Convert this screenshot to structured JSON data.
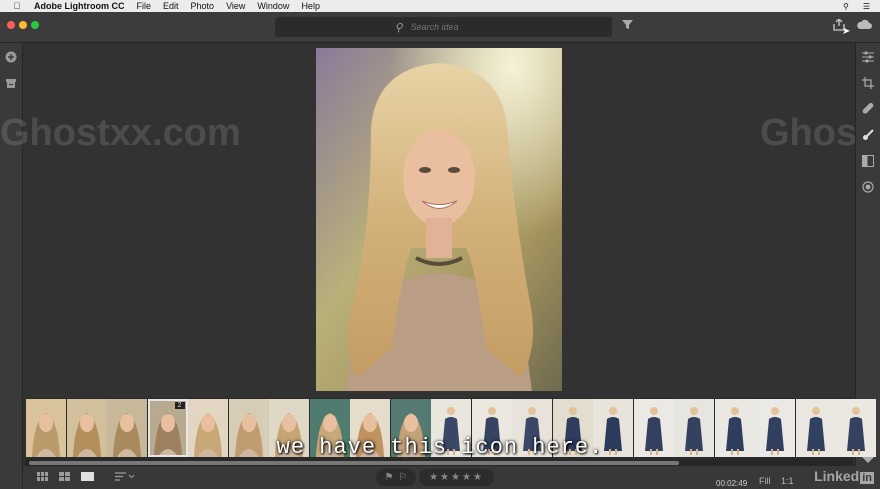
{
  "menubar": {
    "apple_icon": "apple-icon",
    "app_name": "Adobe Lightroom CC",
    "items": [
      "File",
      "Edit",
      "Photo",
      "View",
      "Window",
      "Help"
    ]
  },
  "toolbar": {
    "search_placeholder": "Search idea",
    "search_icon": "search-icon",
    "filter_icon": "filter-icon",
    "share_icon": "share-icon",
    "cloud_icon": "cloud-icon"
  },
  "left_panel": {
    "icons": [
      "add-photos-icon",
      "library-icon"
    ]
  },
  "right_panel": {
    "icons": [
      "edit-sliders-icon",
      "crop-icon",
      "healing-icon",
      "brush-icon",
      "linear-gradient-icon",
      "radial-gradient-icon",
      "keyword-tag-icon"
    ]
  },
  "filmstrip": {
    "selected_index": 3,
    "stack_badge": "2",
    "thumbs": [
      {
        "bg": "#d8c39a",
        "fg": "#b99a6a"
      },
      {
        "bg": "#d2c09c",
        "fg": "#b58e5e"
      },
      {
        "bg": "#c8b89a",
        "fg": "#a88a5c"
      },
      {
        "bg": "#b8aa8e",
        "fg": "#9c8060"
      },
      {
        "bg": "#e2d6c2",
        "fg": "#c9a878"
      },
      {
        "bg": "#d7ccb6",
        "fg": "#c09c70"
      },
      {
        "bg": "#e0d8c6",
        "fg": "#c6a474"
      },
      {
        "bg": "#4f7c6e",
        "fg": "#c8a878"
      },
      {
        "bg": "#e6dccb",
        "fg": "#c09260"
      },
      {
        "bg": "#557a72",
        "fg": "#c3a27a"
      },
      {
        "bg": "#e9e6de",
        "fg": "#3a4766"
      },
      {
        "bg": "#ebe8e0",
        "fg": "#364362"
      },
      {
        "bg": "#e7e3da",
        "fg": "#3a4766"
      },
      {
        "bg": "#e3ddd0",
        "fg": "#2f3c5e"
      },
      {
        "bg": "#e8e4dc",
        "fg": "#2c3a5c"
      },
      {
        "bg": "#ebe9e3",
        "fg": "#33405f"
      },
      {
        "bg": "#e7e5e0",
        "fg": "#34415f"
      },
      {
        "bg": "#e9e8e2",
        "fg": "#2f3d5e"
      },
      {
        "bg": "#ebe9e5",
        "fg": "#32405f"
      },
      {
        "bg": "#e9e7e0",
        "fg": "#304060"
      },
      {
        "bg": "#eae8e1",
        "fg": "#34425f"
      }
    ]
  },
  "bottombar": {
    "view_icons": [
      "square-grid-icon",
      "photo-grid-icon",
      "detail-view-icon",
      "sort-icon"
    ],
    "flag_icons": [
      "pick-flag-icon",
      "reject-flag-icon"
    ],
    "stars": "★★★★★",
    "fill_label": "Fill",
    "zoom_label": "1:1",
    "timecode": "00:02:49"
  },
  "caption": "we have this icon here.",
  "watermark": "Ghostxx.com",
  "linkedin_label": "Linked",
  "colors": {
    "menubar": "#ececec",
    "toolbar": "#3c3c3c",
    "canvas": "#323232",
    "close": "#ff5f57",
    "minimize": "#febc2e",
    "zoom": "#28c840"
  }
}
